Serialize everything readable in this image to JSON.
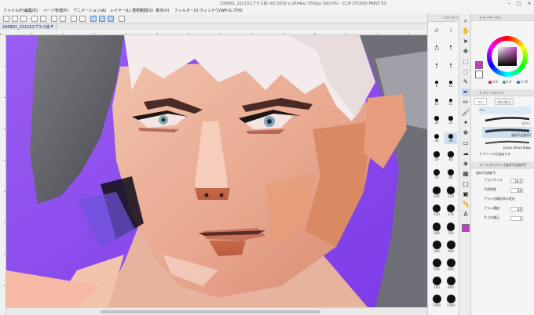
{
  "window": {
    "title": "230801_221152プラス絵 (A3 2639 x 2694px 350dpi 100.0%) - CLIP STUDIO PAINT EX",
    "minimize": "–",
    "maximize": "□",
    "close": "×"
  },
  "menu": [
    "ファイル(F)",
    "編集(E)",
    "ページ管理(P)",
    "アニメーション(A)",
    "レイヤー(L)",
    "選択範囲(S)",
    "表示(V)",
    "フィルター(I)",
    "ウィンドウ(W)",
    "ヘルプ(H)"
  ],
  "document_tab": {
    "label": "230801_221152プラス絵 *",
    "close": "×"
  },
  "brush_size_panel": {
    "header": "ブラシサイズ",
    "sizes": [
      "67",
      "1",
      "1.5",
      "2",
      "3",
      "5",
      "8",
      "10",
      "12",
      "15",
      "20",
      "25",
      "30",
      "40",
      "50",
      "60",
      "70",
      "80",
      "100",
      "120",
      "150",
      "170",
      "200",
      "250",
      "300",
      "400",
      "500",
      "600",
      "700",
      "800",
      "1000",
      "1200"
    ]
  },
  "color_panel": {
    "header": "カラーサークル",
    "hsv_values": [
      "H 0",
      "S 0",
      "V 30"
    ],
    "main_color": "#c43cc4",
    "sub_color": "#ffffff",
    "colors": {
      "accent": "#8d4ff0",
      "selection": "#c9dcf3"
    }
  },
  "subtool_panel": {
    "header": "サブツール[ペン]",
    "tabs": [
      "ペン",
      "マーカー"
    ],
    "items": [
      "ペン",
      "Gペン"
    ],
    "brushes": [
      "塗料不足線/不",
      "Erase Alone Edge"
    ],
    "add_subtool": "サブツールを追加する"
  },
  "tool_property": {
    "header": "ツールプロパティ[塗料不足線/不]",
    "brush_name": "塗料不足線/不",
    "props": [
      {
        "label": "ブラシサイズ",
        "value": "18.0"
      },
      {
        "label": "不透明度",
        "value": "88"
      },
      {
        "label": "ブラシ先端形状の変化",
        "value": ""
      },
      {
        "label": "ブラシ濃度",
        "value": "88"
      },
      {
        "label": "手ぶれ補正",
        "value": "3"
      }
    ],
    "slider_levels": [
      0.3,
      0.88,
      0,
      0.88,
      0.1
    ]
  }
}
